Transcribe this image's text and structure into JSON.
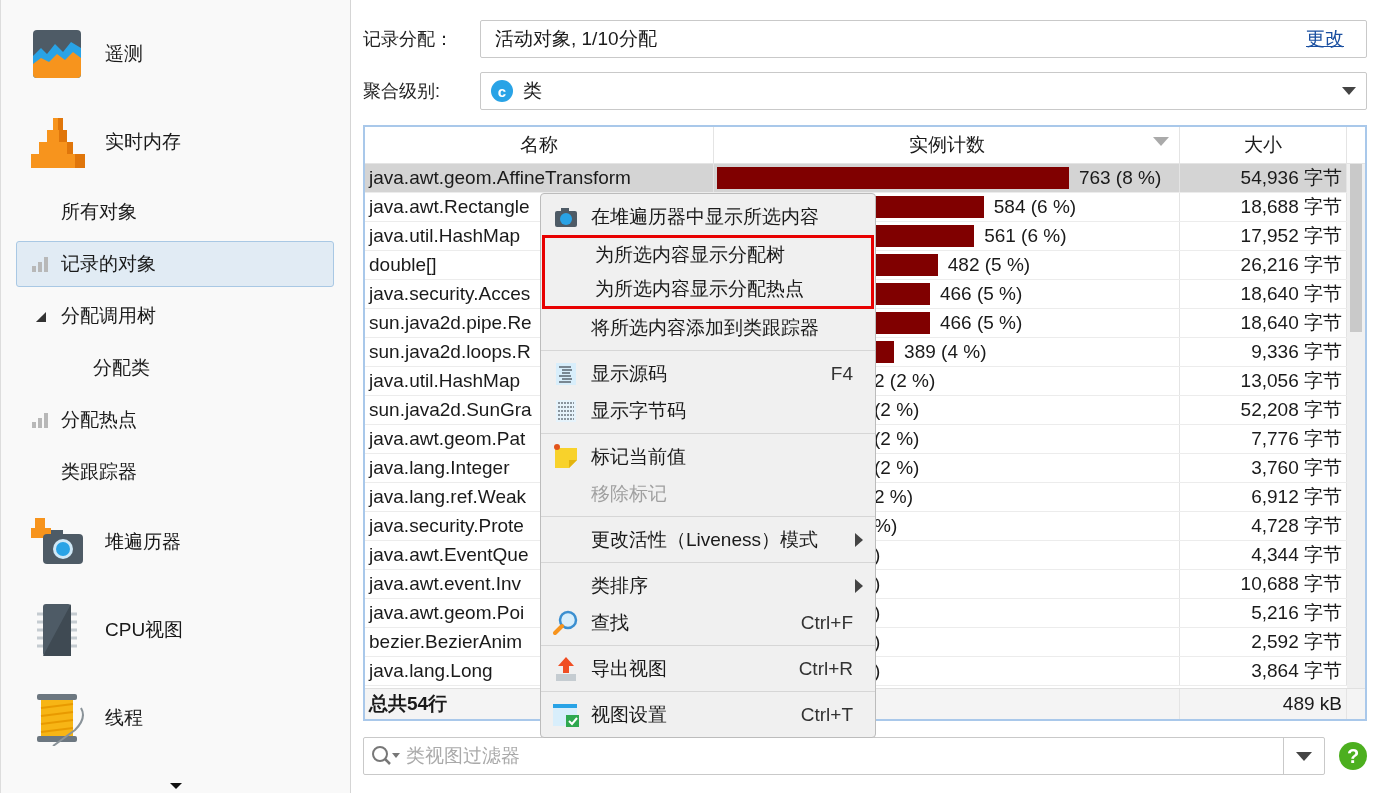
{
  "sidebar": {
    "items": [
      {
        "kind": "section",
        "label": "遥测",
        "selected": false
      },
      {
        "kind": "section",
        "label": "实时内存",
        "selected": false
      },
      {
        "kind": "view",
        "label": "所有对象",
        "recording": false,
        "selected": false
      },
      {
        "kind": "view",
        "label": "记录的对象",
        "recording": true,
        "selected": true
      },
      {
        "kind": "view",
        "label": "分配调用树",
        "recording": false,
        "selected": false,
        "expanded": true,
        "children": [
          {
            "kind": "view",
            "label": "分配类",
            "recording": false,
            "selected": false
          }
        ]
      },
      {
        "kind": "view",
        "label": "分配热点",
        "recording": true,
        "selected": false
      },
      {
        "kind": "view",
        "label": "类跟踪器",
        "recording": false,
        "selected": false
      },
      {
        "kind": "section",
        "label": "堆遍历器",
        "selected": false
      },
      {
        "kind": "section",
        "label": "CPU视图",
        "selected": false
      },
      {
        "kind": "section",
        "label": "线程",
        "selected": false
      }
    ]
  },
  "recording": {
    "label": "记录分配：",
    "value": "活动对象, 1/10分配",
    "link": "更改"
  },
  "aggregation": {
    "label": "聚合级别:",
    "badge": "c",
    "value": "类"
  },
  "table": {
    "columns": [
      {
        "label": "名称",
        "sorted": false
      },
      {
        "label": "实例计数",
        "sorted": true
      },
      {
        "label": "大小",
        "sorted": false
      }
    ],
    "rows": [
      {
        "name": "java.awt.geom.AffineTransform",
        "level": 0.765,
        "count": "763 (8 %)",
        "size": "54,936 字节",
        "selected": true
      },
      {
        "name": "java.awt.Rectangle",
        "level": 0.58,
        "count": "584 (6 %)",
        "size": "18,688 字节",
        "selected": false
      },
      {
        "name": "java.util.HashMap",
        "level": 0.559,
        "count": "561 (6 %)",
        "size": "17,952 字节",
        "selected": false
      },
      {
        "name": "double[]",
        "level": 0.48,
        "count": "482 (5 %)",
        "size": "26,216 字节",
        "selected": false
      },
      {
        "name": "java.security.Acces",
        "level": 0.463,
        "count": "466 (5 %)",
        "size": "18,640 字节",
        "selected": false
      },
      {
        "name": "sun.java2d.pipe.Re",
        "level": 0.463,
        "count": "466 (5 %)",
        "size": "18,640 字节",
        "selected": false
      },
      {
        "name": "sun.java2d.loops.R",
        "level": 0.385,
        "count": "389 (4 %)",
        "size": "9,336 字节",
        "selected": false
      },
      {
        "name": "java.util.HashMap",
        "count": "2 (2 %)",
        "size": "13,056 字节",
        "selected": false
      },
      {
        "name": "sun.java2d.SunGra",
        "count": "(2 %)",
        "size": "52,208 字节",
        "selected": false
      },
      {
        "name": "java.awt.geom.Pat",
        "count": "(2 %)",
        "size": "7,776 字节",
        "selected": false
      },
      {
        "name": "java.lang.Integer",
        "count": "(2 %)",
        "size": "3,760 字节",
        "selected": false
      },
      {
        "name": "java.lang.ref.Weak",
        "count": "2 %)",
        "size": "6,912 字节",
        "selected": false
      },
      {
        "name": "java.security.Prote",
        "count": "%)",
        "size": "4,728 字节",
        "selected": false
      },
      {
        "name": "java.awt.EventQue",
        "count": ")",
        "size": "4,344 字节",
        "selected": false
      },
      {
        "name": "java.awt.event.Inv",
        "count": ")",
        "size": "10,688 字节",
        "selected": false
      },
      {
        "name": "java.awt.geom.Poi",
        "count": ")",
        "size": "5,216 字节",
        "selected": false
      },
      {
        "name": "bezier.BezierAnim",
        "count": ")",
        "size": "2,592 字节",
        "selected": false
      },
      {
        "name": "java.lang.Long",
        "count": ")",
        "size": "3,864 字节",
        "selected": false
      }
    ],
    "footer": {
      "total": "总共54行",
      "size": "489 kB"
    }
  },
  "filter": {
    "placeholder": "类视图过滤器"
  },
  "help": "?",
  "context_menu": {
    "sections": [
      {
        "items": [
          {
            "label": "在堆遍历器中显示所选内容",
            "boxed": false,
            "disabled": false,
            "submenu": false
          },
          {
            "label": "为所选内容显示分配树",
            "boxed": true,
            "disabled": false,
            "submenu": false
          },
          {
            "label": "为所选内容显示分配热点",
            "boxed": true,
            "disabled": false,
            "submenu": false
          },
          {
            "label": "将所选内容添加到类跟踪器",
            "boxed": false,
            "disabled": false,
            "submenu": false
          }
        ]
      },
      {
        "items": [
          {
            "label": "显示源码",
            "shortcut": "F4",
            "boxed": false,
            "disabled": false,
            "submenu": false
          },
          {
            "label": "显示字节码",
            "boxed": false,
            "disabled": false,
            "submenu": false
          }
        ]
      },
      {
        "items": [
          {
            "label": "标记当前值",
            "boxed": false,
            "disabled": false,
            "submenu": false
          },
          {
            "label": "移除标记",
            "boxed": false,
            "disabled": true,
            "submenu": false
          }
        ]
      },
      {
        "items": [
          {
            "label": "更改活性（Liveness）模式",
            "submenu": true,
            "boxed": false,
            "disabled": false
          }
        ]
      },
      {
        "items": [
          {
            "label": "类排序",
            "submenu": true,
            "boxed": false,
            "disabled": false
          },
          {
            "label": "查找",
            "shortcut": "Ctrl+F",
            "boxed": false,
            "disabled": false,
            "submenu": false
          }
        ]
      },
      {
        "items": [
          {
            "label": "导出视图",
            "shortcut": "Ctrl+R",
            "boxed": false,
            "disabled": false,
            "submenu": false
          }
        ]
      },
      {
        "items": [
          {
            "label": "视图设置",
            "shortcut": "Ctrl+T",
            "boxed": false,
            "disabled": false,
            "submenu": false
          }
        ]
      }
    ]
  }
}
